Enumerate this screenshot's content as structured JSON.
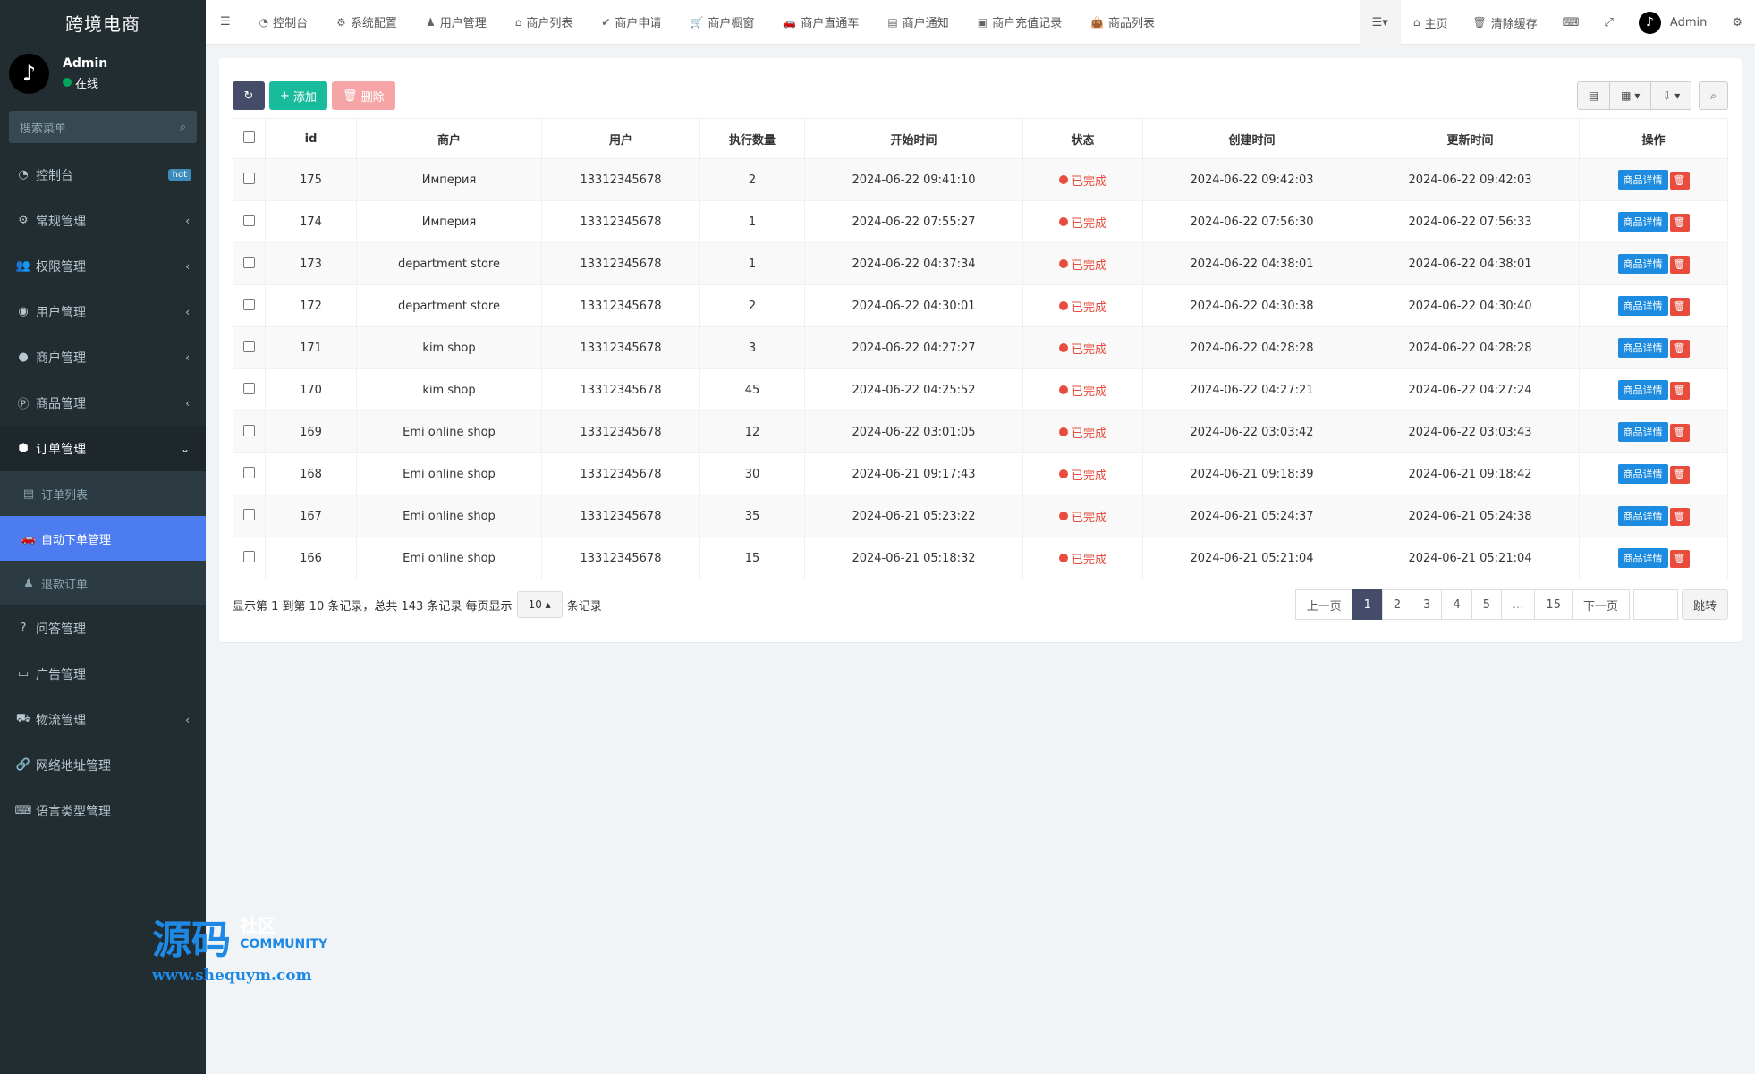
{
  "brand": "跨境电商",
  "user": {
    "name": "Admin",
    "status": "在线",
    "avatar_glyph": "♪"
  },
  "search": {
    "placeholder": "搜索菜单"
  },
  "sidebar": {
    "items": [
      {
        "label": "控制台",
        "icon": "dashboard-icon",
        "glyph": "◔",
        "badge": "hot"
      },
      {
        "label": "常规管理",
        "icon": "cogs-icon",
        "glyph": "⚙",
        "chevron": "‹"
      },
      {
        "label": "权限管理",
        "icon": "group-icon",
        "glyph": "👥",
        "chevron": "‹"
      },
      {
        "label": "用户管理",
        "icon": "user-circle-icon",
        "glyph": "◉",
        "chevron": "‹"
      },
      {
        "label": "商户管理",
        "icon": "apple-icon",
        "glyph": "●",
        "chevron": "‹"
      },
      {
        "label": "商品管理",
        "icon": "product-hunt-icon",
        "glyph": "Ⓟ",
        "chevron": "‹"
      },
      {
        "label": "订单管理",
        "icon": "cube-icon",
        "glyph": "⬢",
        "chevron": "⌄"
      }
    ],
    "sub_items": [
      {
        "label": "订单列表",
        "icon": "list-alt-icon",
        "glyph": "▤"
      },
      {
        "label": "自动下单管理",
        "icon": "car-icon",
        "glyph": "🚗"
      },
      {
        "label": "退款订单",
        "icon": "user-secret-icon",
        "glyph": "♟"
      }
    ],
    "items2": [
      {
        "label": "问答管理",
        "icon": "question-circle-icon",
        "glyph": "?"
      },
      {
        "label": "广告管理",
        "icon": "credit-card-icon",
        "glyph": "▭"
      },
      {
        "label": "物流管理",
        "icon": "truck-icon",
        "glyph": "⛟",
        "chevron": "‹"
      },
      {
        "label": "网络地址管理",
        "icon": "link-icon",
        "glyph": "🔗"
      },
      {
        "label": "语言类型管理",
        "icon": "language-icon",
        "glyph": "⌨"
      }
    ]
  },
  "header": {
    "tabs": [
      {
        "label": "控制台",
        "icon": "dashboard-icon",
        "glyph": "◔"
      },
      {
        "label": "系统配置",
        "icon": "gear-icon",
        "glyph": "⚙"
      },
      {
        "label": "用户管理",
        "icon": "user-icon",
        "glyph": "♟"
      },
      {
        "label": "商户列表",
        "icon": "home-icon",
        "glyph": "⌂"
      },
      {
        "label": "商户申请",
        "icon": "check-circle-icon",
        "glyph": "✔"
      },
      {
        "label": "商户橱窗",
        "icon": "cart-icon",
        "glyph": "🛒"
      },
      {
        "label": "商户直通车",
        "icon": "car-icon",
        "glyph": "🚗"
      },
      {
        "label": "商户通知",
        "icon": "list-alt-icon",
        "glyph": "▤"
      },
      {
        "label": "商户充值记录",
        "icon": "money-icon",
        "glyph": "▣"
      },
      {
        "label": "商品列表",
        "icon": "shopping-bag-icon",
        "glyph": "👜"
      }
    ],
    "right": {
      "home": "主页",
      "clear_cache": "清除缓存",
      "admin": "Admin"
    }
  },
  "toolbar": {
    "add": "添加",
    "delete": "删除"
  },
  "table": {
    "headers": [
      "id",
      "商户",
      "用户",
      "执行数量",
      "开始时间",
      "状态",
      "创建时间",
      "更新时间",
      "操作"
    ],
    "detail_label": "商品详情",
    "rows": [
      {
        "id": "175",
        "merchant": "Империя",
        "user": "13312345678",
        "qty": "2",
        "start": "2024-06-22 09:41:10",
        "status": "已完成",
        "created": "2024-06-22 09:42:03",
        "updated": "2024-06-22 09:42:03"
      },
      {
        "id": "174",
        "merchant": "Империя",
        "user": "13312345678",
        "qty": "1",
        "start": "2024-06-22 07:55:27",
        "status": "已完成",
        "created": "2024-06-22 07:56:30",
        "updated": "2024-06-22 07:56:33"
      },
      {
        "id": "173",
        "merchant": "department store",
        "user": "13312345678",
        "qty": "1",
        "start": "2024-06-22 04:37:34",
        "status": "已完成",
        "created": "2024-06-22 04:38:01",
        "updated": "2024-06-22 04:38:01"
      },
      {
        "id": "172",
        "merchant": "department store",
        "user": "13312345678",
        "qty": "2",
        "start": "2024-06-22 04:30:01",
        "status": "已完成",
        "created": "2024-06-22 04:30:38",
        "updated": "2024-06-22 04:30:40"
      },
      {
        "id": "171",
        "merchant": "kim shop",
        "user": "13312345678",
        "qty": "3",
        "start": "2024-06-22 04:27:27",
        "status": "已完成",
        "created": "2024-06-22 04:28:28",
        "updated": "2024-06-22 04:28:28"
      },
      {
        "id": "170",
        "merchant": "kim shop",
        "user": "13312345678",
        "qty": "45",
        "start": "2024-06-22 04:25:52",
        "status": "已完成",
        "created": "2024-06-22 04:27:21",
        "updated": "2024-06-22 04:27:24"
      },
      {
        "id": "169",
        "merchant": "Emi online shop",
        "user": "13312345678",
        "qty": "12",
        "start": "2024-06-22 03:01:05",
        "status": "已完成",
        "created": "2024-06-22 03:03:42",
        "updated": "2024-06-22 03:03:43"
      },
      {
        "id": "168",
        "merchant": "Emi online shop",
        "user": "13312345678",
        "qty": "30",
        "start": "2024-06-21 09:17:43",
        "status": "已完成",
        "created": "2024-06-21 09:18:39",
        "updated": "2024-06-21 09:18:42"
      },
      {
        "id": "167",
        "merchant": "Emi online shop",
        "user": "13312345678",
        "qty": "35",
        "start": "2024-06-21 05:23:22",
        "status": "已完成",
        "created": "2024-06-21 05:24:37",
        "updated": "2024-06-21 05:24:38"
      },
      {
        "id": "166",
        "merchant": "Emi online shop",
        "user": "13312345678",
        "qty": "15",
        "start": "2024-06-21 05:18:32",
        "status": "已完成",
        "created": "2024-06-21 05:21:04",
        "updated": "2024-06-21 05:21:04"
      }
    ]
  },
  "footer": {
    "info_prefix": "显示第 1 到第 10 条记录，总共 143 条记录 每页显示",
    "per_page": "10",
    "info_suffix": "条记录"
  },
  "pager": {
    "prev": "上一页",
    "pages": [
      "1",
      "2",
      "3",
      "4",
      "5",
      "...",
      "15"
    ],
    "next": "下一页",
    "jump": "跳转"
  },
  "watermark": {
    "big": "源码",
    "cn": "社区",
    "en": "COMMUNITY",
    "url": "www.shequym.com"
  },
  "colors": {
    "sidebar": "#222d32",
    "active": "#4d7cf0",
    "status_red": "#e74c3c",
    "btn_green": "#18bc9c",
    "btn_dark": "#444c69"
  }
}
